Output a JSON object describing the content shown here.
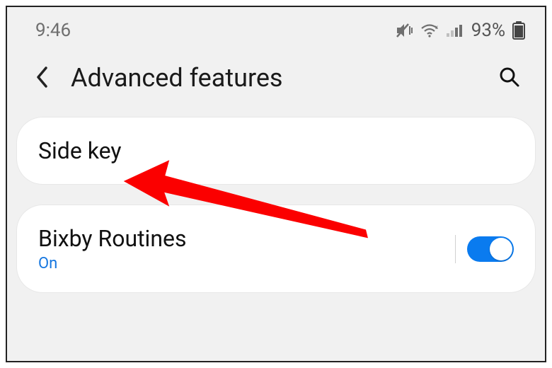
{
  "status": {
    "time": "9:46",
    "battery_percent": "93%"
  },
  "header": {
    "title": "Advanced features"
  },
  "items": {
    "sidekey": {
      "title": "Side key"
    },
    "bixby": {
      "title": "Bixby Routines",
      "status": "On"
    }
  }
}
